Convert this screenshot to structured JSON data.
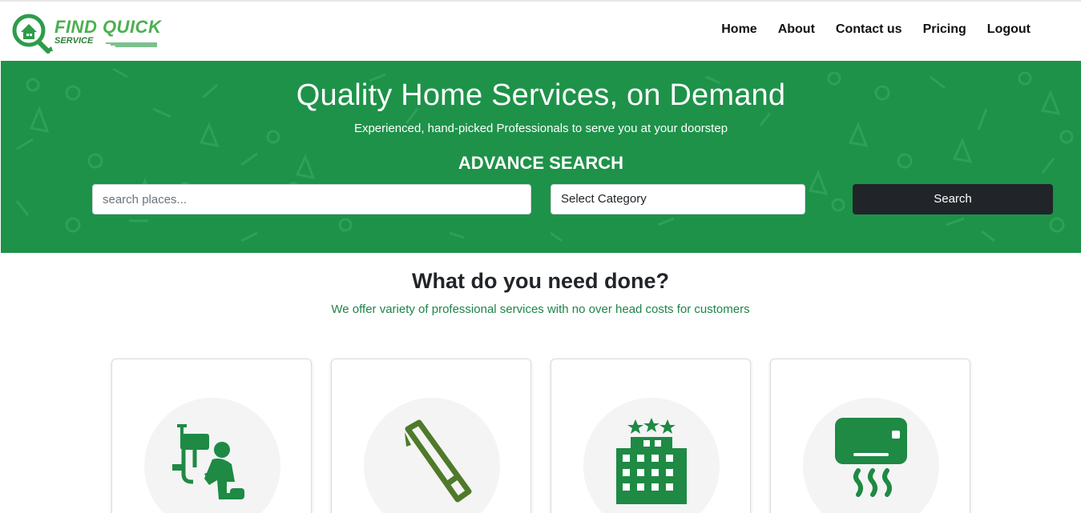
{
  "brand": {
    "name_line1": "FIND QUICK",
    "name_line2": "SERVICE",
    "color": "#4caf50"
  },
  "nav": {
    "items": [
      {
        "label": "Home"
      },
      {
        "label": "About"
      },
      {
        "label": "Contact us"
      },
      {
        "label": "Pricing"
      },
      {
        "label": "Logout"
      }
    ]
  },
  "hero": {
    "title": "Quality Home Services, on Demand",
    "subtitle": "Experienced, hand-picked Professionals to serve you at your doorstep",
    "advance_search_title": "ADVANCE SEARCH",
    "background_color": "#1e9249",
    "search": {
      "placeholder": "search places...",
      "value": ""
    },
    "category_select": {
      "selected": "Select Category"
    },
    "search_button_label": "Search"
  },
  "services_section": {
    "title": "What do you need done?",
    "subtitle": "We offer variety of professional services with no over head costs for customers",
    "cards": [
      {
        "icon": "plumber-icon"
      },
      {
        "icon": "saw-icon"
      },
      {
        "icon": "hotel-building-icon"
      },
      {
        "icon": "air-conditioner-icon"
      }
    ]
  },
  "colors": {
    "primary_green": "#1e9249",
    "dark_button": "#212529",
    "icon_green": "#1e8a44",
    "saw_green": "#4e7a2a"
  }
}
